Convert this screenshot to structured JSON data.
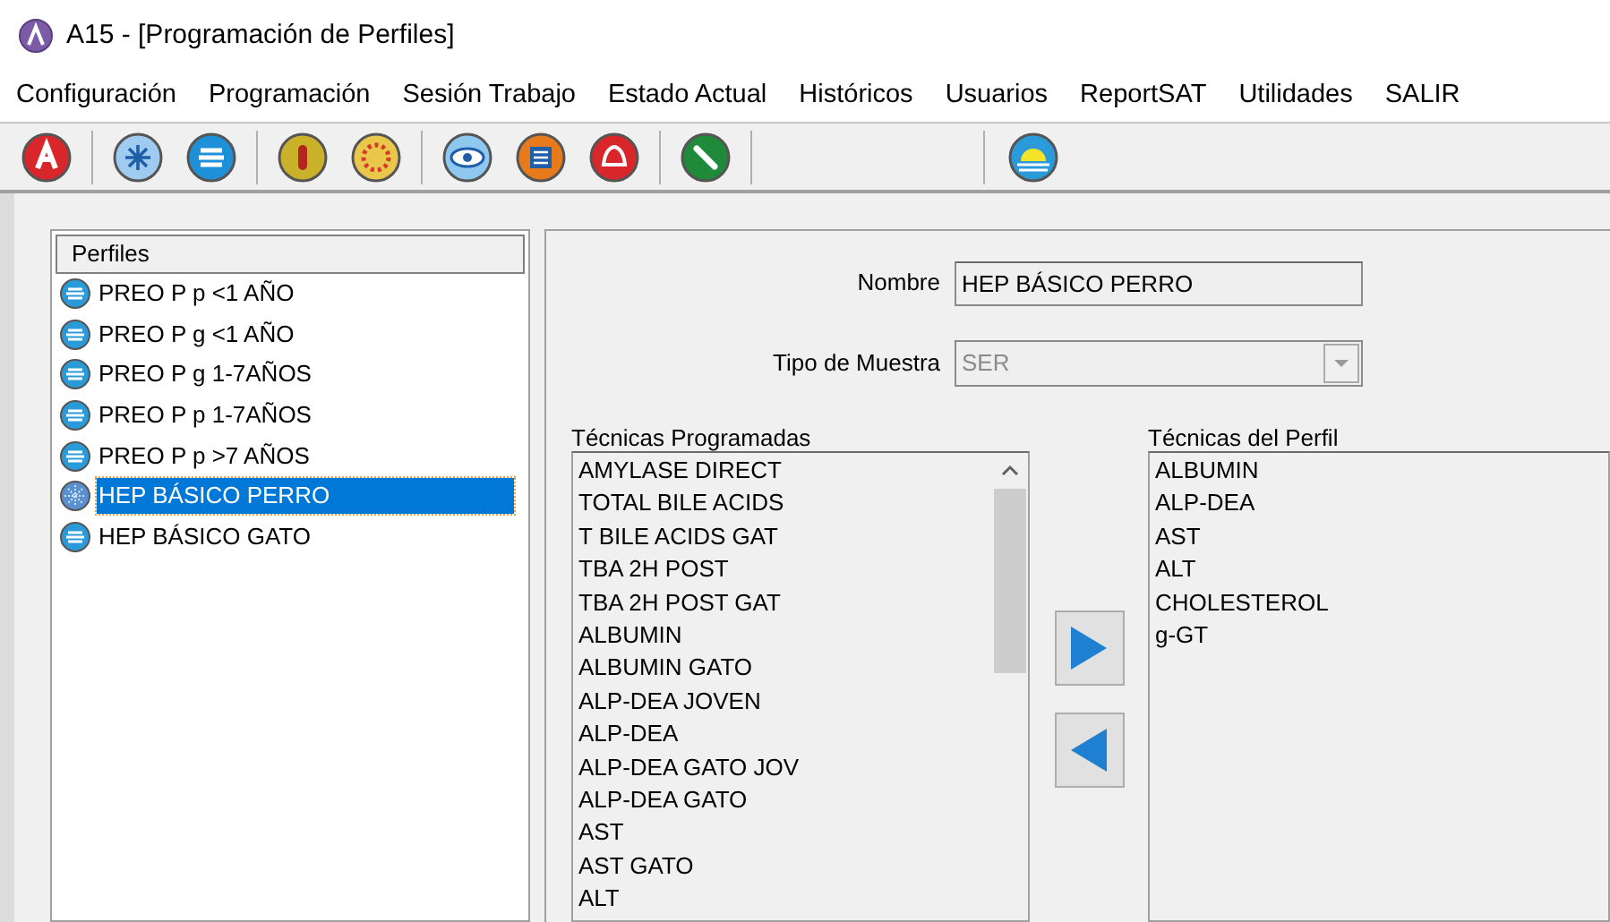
{
  "window": {
    "title": "A15 - [Programación de Perfiles]"
  },
  "menu": [
    "Configuración",
    "Programación",
    "Sesión Trabajo",
    "Estado Actual",
    "Históricos",
    "Usuarios",
    "ReportSAT",
    "Utilidades",
    "SALIR"
  ],
  "profiles": {
    "header": "Perfiles",
    "items": [
      {
        "label": "PREO P p <1 AÑO",
        "selected": false
      },
      {
        "label": "PREO P g <1 AÑO",
        "selected": false
      },
      {
        "label": "PREO P g 1-7AÑOS",
        "selected": false
      },
      {
        "label": "PREO P p 1-7AÑOS",
        "selected": false
      },
      {
        "label": "PREO P p >7 AÑOS",
        "selected": false
      },
      {
        "label": "HEP BÁSICO PERRO",
        "selected": true
      },
      {
        "label": "HEP BÁSICO GATO",
        "selected": false
      }
    ]
  },
  "form": {
    "name_label": "Nombre",
    "name_value": "HEP BÁSICO PERRO",
    "sample_label": "Tipo de Muestra",
    "sample_value": "SER",
    "sample_disabled": true
  },
  "programmed": {
    "title": "Técnicas Programadas",
    "items": [
      "AMYLASE DIRECT",
      "TOTAL BILE ACIDS",
      "T BILE ACIDS GAT",
      "TBA 2H POST",
      "TBA 2H POST GAT",
      "ALBUMIN",
      "ALBUMIN GATO",
      "ALP-DEA JOVEN",
      "ALP-DEA",
      "ALP-DEA GATO JOV",
      "ALP-DEA GATO",
      "AST",
      "AST GATO",
      "ALT"
    ]
  },
  "profile_techniques": {
    "title": "Técnicas del Perfil",
    "items": [
      "ALBUMIN",
      "ALP-DEA",
      "AST",
      "ALT",
      "CHOLESTEROL",
      "g-GT"
    ]
  }
}
